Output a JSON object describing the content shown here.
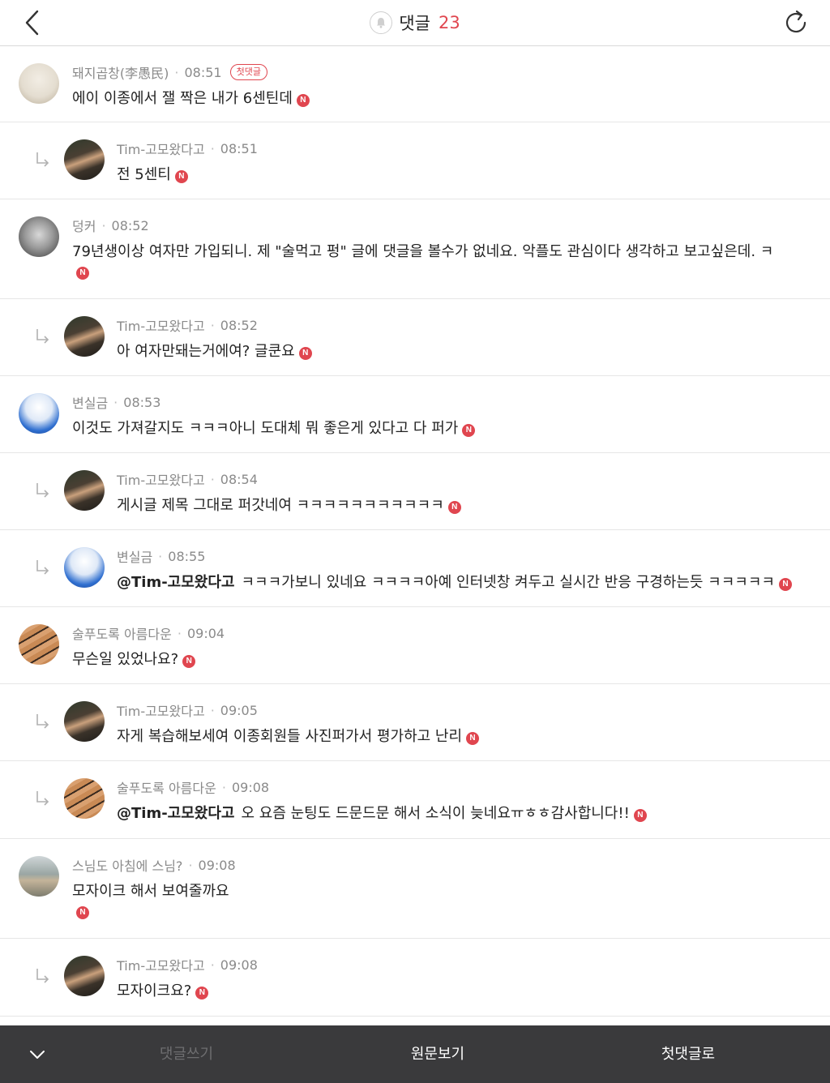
{
  "header": {
    "title": "댓글",
    "count": "23"
  },
  "comments": [
    {
      "author": "돼지곱창(李愚民)",
      "time": "08:51",
      "badge": "첫댓글",
      "text": "에이 이종에서 잴 짝은 내가 6센틴데"
    },
    {
      "author": "Tim-고모왔다고",
      "time": "08:51",
      "text": "전 5센티"
    },
    {
      "author": "덩커",
      "time": "08:52",
      "text": "79년생이상 여자만 가입되니. 제 \"술먹고 펑\" 글에 댓글을 볼수가 없네요. 악플도 관심이다 생각하고 보고싶은데. ㅋ"
    },
    {
      "author": "Tim-고모왔다고",
      "time": "08:52",
      "text": "아 여자만돼는거에여? 글쿤요"
    },
    {
      "author": "변실금",
      "time": "08:53",
      "text": "이것도 가져갈지도 ㅋㅋㅋ아니 도대체 뭐 좋은게 있다고 다 퍼가"
    },
    {
      "author": "Tim-고모왔다고",
      "time": "08:54",
      "text": "게시글 제목 그대로 퍼갓네여 ㅋㅋㅋㅋㅋㅋㅋㅋㅋㅋㅋ"
    },
    {
      "author": "변실금",
      "time": "08:55",
      "mention": "@Tim-고모왔다고",
      "text": "ㅋㅋㅋ가보니 있네요 ㅋㅋㅋㅋ아예 인터넷창 켜두고 실시간 반응 구경하는듯 ㅋㅋㅋㅋㅋ"
    },
    {
      "author": "술푸도록 아름다운",
      "time": "09:04",
      "text": "무슨일 있었나요?"
    },
    {
      "author": "Tim-고모왔다고",
      "time": "09:05",
      "text": "자게 복습해보세여 이종회원들 사진퍼가서 평가하고 난리"
    },
    {
      "author": "술푸도록 아름다운",
      "time": "09:08",
      "mention": "@Tim-고모왔다고",
      "text": "오 요즘 눈팅도 드문드문 해서 소식이 늦네요ㅠㅎㅎ감사합니다!!"
    },
    {
      "author": "스님도 아침에 스님?",
      "time": "09:08",
      "text": "모자이크 해서 보여줄까요"
    },
    {
      "author": "Tim-고모왔다고",
      "time": "09:08",
      "text": "모자이크요?"
    }
  ],
  "new_badge": "N",
  "bottombar": {
    "write": "댓글쓰기",
    "original": "원문보기",
    "first_comment": "첫댓글로"
  },
  "colors": {
    "accent": "#e0464f",
    "bottombar_bg": "#3a3a3c"
  },
  "icons": [
    "back-arrow-icon",
    "bell-icon",
    "refresh-icon",
    "reply-arrow-icon",
    "chevron-down-icon"
  ]
}
